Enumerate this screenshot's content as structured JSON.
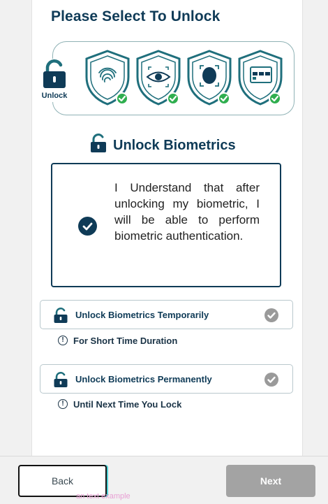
{
  "header": {
    "title": "Please Select To Unlock"
  },
  "unlock_tile": {
    "label": "Unlock",
    "icon": "lock-icon"
  },
  "methods": [
    {
      "name": "fingerprint",
      "icon": "fingerprint-shield-icon",
      "checked": true
    },
    {
      "name": "eye",
      "icon": "eye-shield-icon",
      "checked": true
    },
    {
      "name": "face",
      "icon": "face-shield-icon",
      "checked": true
    },
    {
      "name": "card",
      "icon": "card-shield-icon",
      "checked": true
    }
  ],
  "section": {
    "title": "Unlock Biometrics",
    "icon": "unlock-icon"
  },
  "consent": {
    "text": "I Understand that after unlocking my biometric, I will be able to perform biometric authentication.",
    "checked": true
  },
  "options": [
    {
      "label": "Unlock Biometrics Temporarily",
      "hint": "For Short Time Duration"
    },
    {
      "label": "Unlock Biometrics Permanently",
      "hint": "Until Next Time You Lock"
    }
  ],
  "footer": {
    "back_label": "Back",
    "next_label": "Next",
    "alt_text": "an text example"
  },
  "colors": {
    "primary": "#0f3b57",
    "accent_teal": "#1f6f7c",
    "success": "#2fae4f",
    "disabled": "#a3a3a3"
  }
}
